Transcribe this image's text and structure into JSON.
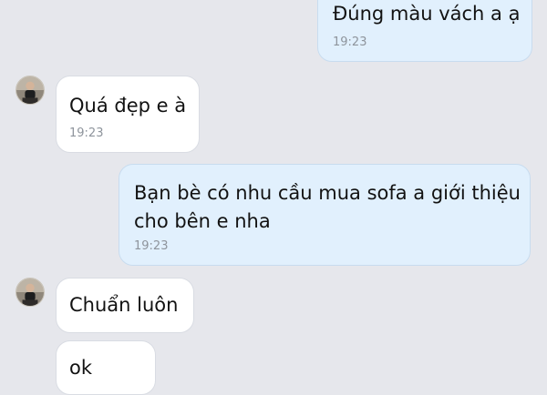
{
  "messages": [
    {
      "sender": "me",
      "text": "Đúng màu vách a ạ",
      "time": "19:23"
    },
    {
      "sender": "contact",
      "text": "Quá đẹp e à",
      "time": "19:23"
    },
    {
      "sender": "me",
      "lines": [
        "Bạn bè có nhu cầu mua sofa a giới thiệu",
        "cho bên e nha"
      ],
      "time": "19:23"
    },
    {
      "sender": "contact",
      "text": "Chuẩn luôn"
    },
    {
      "sender": "contact",
      "text_partial": "ok"
    }
  ],
  "contact": {
    "avatar_icon": "contact-avatar-icon"
  },
  "colors": {
    "background": "#e6e7ec",
    "outgoing_bubble": "#e1f0fd",
    "incoming_bubble": "#ffffff",
    "text": "#121212",
    "timestamp": "#8e949c"
  }
}
